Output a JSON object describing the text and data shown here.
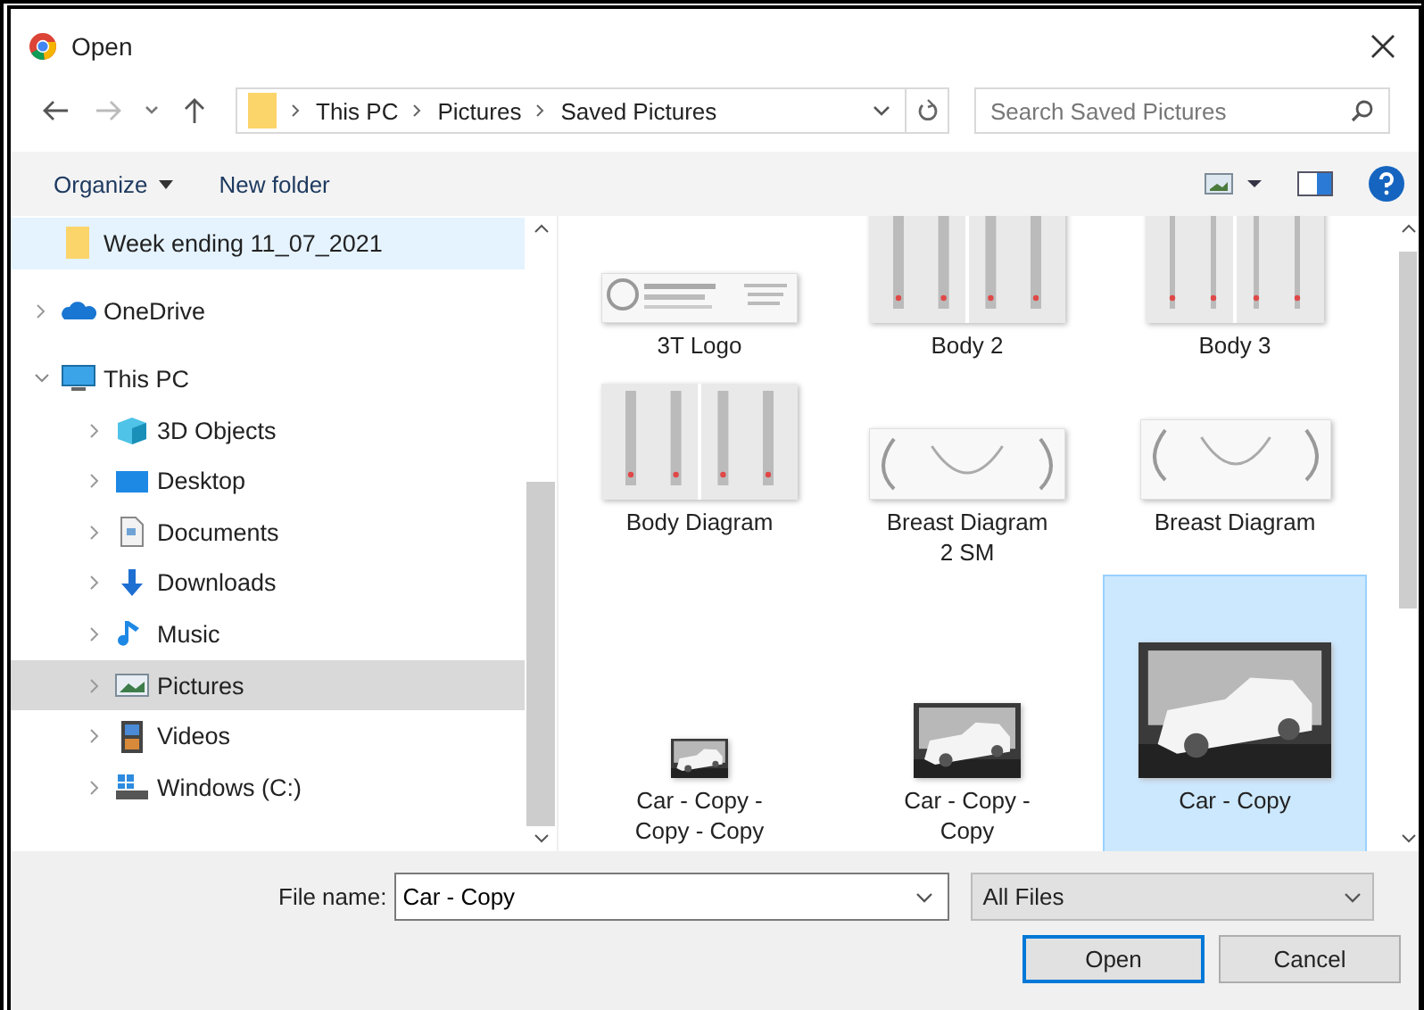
{
  "window": {
    "title": "Open"
  },
  "navigation": {
    "path": [
      "This PC",
      "Pictures",
      "Saved Pictures"
    ],
    "search": {
      "placeholder": "Search Saved Pictures"
    }
  },
  "toolbar": {
    "buttons": [
      {
        "label": "Organize",
        "dropdown": true
      },
      {
        "label": "New folder",
        "dropdown": false
      }
    ]
  },
  "sidebar": {
    "items": [
      {
        "label": "Week ending 11_07_2021",
        "kind": "folder",
        "hovered": true,
        "selected": false
      },
      {
        "label": "OneDrive",
        "kind": "cloud",
        "expanded": false,
        "hovered": false,
        "selected": false
      },
      {
        "label": "This PC",
        "kind": "computer",
        "expanded": true,
        "hovered": false,
        "selected": false,
        "children": [
          {
            "label": "3D Objects",
            "kind": "cube",
            "expanded": false,
            "hovered": false,
            "selected": false
          },
          {
            "label": "Desktop",
            "kind": "desktop",
            "expanded": false,
            "hovered": false,
            "selected": false
          },
          {
            "label": "Documents",
            "kind": "document",
            "expanded": false,
            "hovered": false,
            "selected": false
          },
          {
            "label": "Downloads",
            "kind": "download",
            "expanded": false,
            "hovered": false,
            "selected": false
          },
          {
            "label": "Music",
            "kind": "music",
            "expanded": false,
            "hovered": false,
            "selected": false
          },
          {
            "label": "Pictures",
            "kind": "pictures",
            "expanded": false,
            "hovered": false,
            "selected": true
          },
          {
            "label": "Videos",
            "kind": "film",
            "expanded": false,
            "hovered": false,
            "selected": false
          },
          {
            "label": "Windows (C:)",
            "kind": "drive",
            "expanded": false,
            "hovered": false,
            "selected": false
          }
        ]
      }
    ]
  },
  "files": [
    {
      "name": "3T Logo",
      "kind": "logo",
      "selected": false
    },
    {
      "name": "Body 2",
      "kind": "figures",
      "selected": false
    },
    {
      "name": "Body 3",
      "kind": "legs",
      "selected": false
    },
    {
      "name": "Body Diagram",
      "kind": "figures",
      "selected": false
    },
    {
      "name": "Breast Diagram 2 SM",
      "kind": "outline",
      "selected": false
    },
    {
      "name": "Breast Diagram",
      "kind": "outline",
      "selected": false
    },
    {
      "name": "Car - Copy - Copy - Copy",
      "selected": false
    },
    {
      "name": "Car - Copy - Copy",
      "selected": false
    },
    {
      "name": "Car - Copy",
      "selected": true
    }
  ],
  "footer": {
    "file_name_label": "File name:",
    "file_name": "Car - Copy",
    "filter": "All Files",
    "buttons": [
      {
        "label": "Open",
        "default": true
      },
      {
        "label": "Cancel",
        "default": false
      }
    ]
  }
}
